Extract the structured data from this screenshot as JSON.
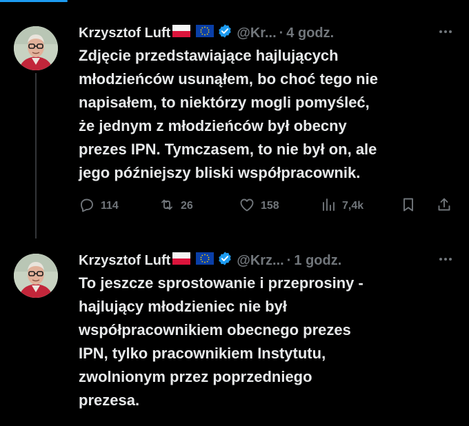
{
  "tweets": [
    {
      "author": {
        "name": "Krzysztof Luft",
        "handle": "@Kr...",
        "flags": [
          "poland-flag",
          "eu-flag"
        ],
        "verified": true
      },
      "time": "4 godz.",
      "text_lines": [
        "Zdjęcie przedstawiające hajlujących",
        "młodzieńców usunąłem, bo choć tego nie",
        "napisałem, to niektórzy mogli pomyśleć,",
        "że jednym z młodzieńców był obecny",
        "prezes IPN. Tymczasem, to nie był on, ale",
        "jego późniejszy bliski współpracownik."
      ],
      "actions": {
        "replies": "114",
        "retweets": "26",
        "likes": "158",
        "views": "7,4k"
      }
    },
    {
      "author": {
        "name": "Krzysztof Luft",
        "handle": "@Krz...",
        "flags": [
          "poland-flag",
          "eu-flag"
        ],
        "verified": true
      },
      "time": "1 godz.",
      "text_lines": [
        "To jeszcze sprostowanie i przeprosiny -",
        "hajlujący młodzieniec nie był",
        "współpracownikiem obecnego prezes",
        "IPN, tylko pracownikiem Instytutu,",
        "zwolnionym przez poprzedniego",
        "prezesa."
      ]
    }
  ],
  "separator": "·",
  "colors": {
    "background": "#000000",
    "text": "#e7e9ea",
    "secondary": "#71767b",
    "accent": "#1d9bf0",
    "thread_line": "#333639"
  },
  "icons": [
    "reply-icon",
    "retweet-icon",
    "like-icon",
    "views-icon",
    "bookmark-icon",
    "share-icon",
    "more-icon",
    "verified-badge-icon"
  ]
}
